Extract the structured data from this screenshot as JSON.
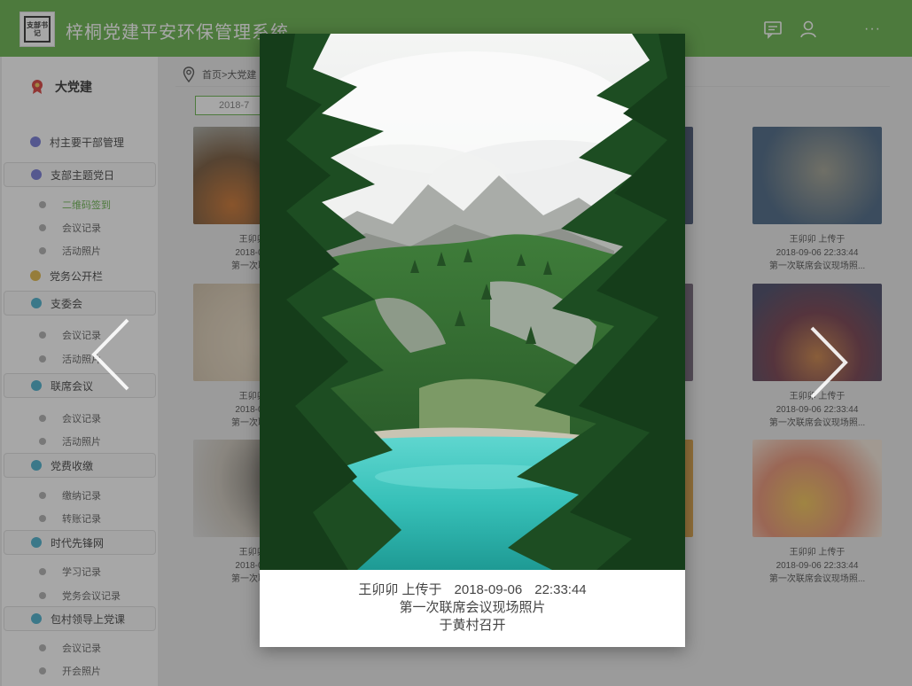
{
  "header": {
    "logo_text": "支部书记",
    "title": "梓桐党建平安环保管理系统",
    "dots": "···",
    "icons": [
      "message-icon",
      "user-icon"
    ]
  },
  "sidebar": {
    "brand": "大党建",
    "groups": [
      {
        "label": "村主要干部管理",
        "color": "#6b6fd4",
        "boxed": false,
        "items": []
      },
      {
        "label": "支部主题党日",
        "color": "#6b6fd4",
        "boxed": true,
        "items": [
          {
            "label": "二维码签到",
            "active": true
          },
          {
            "label": "会议记录",
            "active": false
          },
          {
            "label": "活动照片",
            "active": false
          }
        ]
      },
      {
        "label": "党务公开栏",
        "color": "#e0b23a",
        "boxed": false,
        "items": []
      },
      {
        "label": "支委会",
        "color": "#3ba9c9",
        "boxed": true,
        "items": [
          {
            "label": "会议记录",
            "active": false
          },
          {
            "label": "活动照片",
            "active": false
          }
        ]
      },
      {
        "label": "联席会议",
        "color": "#3ba9c9",
        "boxed": true,
        "items": [
          {
            "label": "会议记录",
            "active": false
          },
          {
            "label": "活动照片",
            "active": false
          }
        ]
      },
      {
        "label": "党费收缴",
        "color": "#3ba9c9",
        "boxed": true,
        "items": [
          {
            "label": "缴纳记录",
            "active": false
          },
          {
            "label": "转账记录",
            "active": false
          }
        ]
      },
      {
        "label": "时代先锋网",
        "color": "#3ba9c9",
        "boxed": true,
        "items": [
          {
            "label": "学习记录",
            "active": false
          },
          {
            "label": "党务会议记录",
            "active": false
          }
        ]
      },
      {
        "label": "包村领导上党课",
        "color": "#3ba9c9",
        "boxed": true,
        "items": [
          {
            "label": "会议记录",
            "active": false
          },
          {
            "label": "开会照片",
            "active": false
          }
        ]
      }
    ]
  },
  "breadcrumb": "首页>大党建",
  "date_filter": "2018-7",
  "cards_left": [
    {
      "uploader": "王卯卯 上",
      "time": "2018-09-06",
      "desc": "第一次联席会"
    },
    {
      "uploader": "王卯卯 上",
      "time": "2018-09-06",
      "desc": "第一次联席会"
    },
    {
      "uploader": "王卯卯 上",
      "time": "2018-09-06",
      "desc": "第一次联席会"
    }
  ],
  "cards_right": [
    {
      "uploader": "王卯卯 上传于",
      "time": "2018-09-06  22:33:44",
      "desc": "第一次联席会议现场照..."
    },
    {
      "uploader": "王卯卯 上传于",
      "time": "2018-09-06  22:33:44",
      "desc": "第一次联席会议现场照..."
    },
    {
      "uploader": "王卯卯 上传于",
      "time": "2018-09-06  22:33:44",
      "desc": "第一次联席会议现场照..."
    }
  ],
  "modal": {
    "uploader": "王卯卯 上传于",
    "date": "2018-09-06",
    "time": "22:33:44",
    "title": "第一次联席会议现场照片",
    "location": "于黄村召开"
  },
  "colors": {
    "brand_green": "#5cae3e",
    "lake": "#3cc6c0",
    "forest": "#1f5a2a"
  }
}
